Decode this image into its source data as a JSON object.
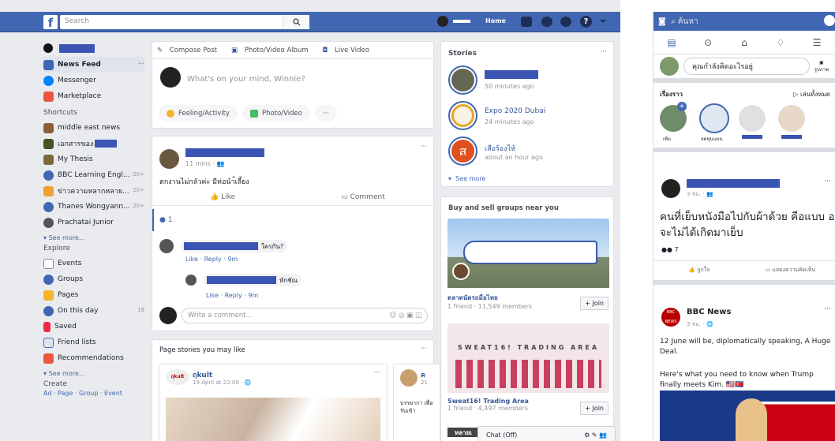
{
  "topbar": {
    "search_placeholder": "Search",
    "home": "Home"
  },
  "nav": {
    "items": [
      {
        "label": "News Feed",
        "more": "···"
      },
      {
        "label": "Messenger"
      },
      {
        "label": "Marketplace"
      }
    ],
    "shortcuts_heading": "Shortcuts",
    "shortcuts": [
      {
        "label": "middle east news",
        "count": ""
      },
      {
        "label": "เอกสารของ",
        "count": ""
      },
      {
        "label": "My Thesis",
        "count": ""
      },
      {
        "label": "BBC Learning Engl...",
        "count": "20+"
      },
      {
        "label": "ข่าวความหลากหลาย...",
        "count": "20+"
      },
      {
        "label": "Thanes Wongyann...",
        "count": "20+"
      },
      {
        "label": "Prachatai Junior",
        "count": ""
      }
    ],
    "see_more": "See more...",
    "explore_heading": "Explore",
    "explore": [
      {
        "label": "Events",
        "count": ""
      },
      {
        "label": "Groups",
        "count": ""
      },
      {
        "label": "Pages",
        "count": ""
      },
      {
        "label": "On this day",
        "count": "19"
      },
      {
        "label": "Saved",
        "count": ""
      },
      {
        "label": "Friend lists",
        "count": ""
      },
      {
        "label": "Recommendations",
        "count": ""
      }
    ],
    "see_more2": "See more...",
    "create_heading": "Create",
    "create_links": "Ad · Page · Group · Event",
    "icon_colors": [
      "#4267b2",
      "#0084ff",
      "#e9573f",
      "#8b5e3c",
      "#445522",
      "#7a6a3a",
      "#4267b2",
      "#f0a030",
      "#4267b2",
      "#555555",
      "#4267b2",
      "#4267b2",
      "#f5b42a",
      "#4267b2",
      "#f02849",
      "#4267b2",
      "#e9573f"
    ]
  },
  "composer": {
    "tabs": [
      "Compose Post",
      "Photo/Video Album",
      "Live Video"
    ],
    "placeholder": "What's on your mind, Winnie?",
    "chips": [
      "Feeling/Activity",
      "Photo/Video",
      "···"
    ]
  },
  "post": {
    "time": "11 mins · 👥",
    "text": "ตกงานไม่กลัวค่ะ มีห่อนำ้เลี้ยง",
    "like": "Like",
    "comment": "Comment",
    "reactions": "1",
    "comment1_text": "ใครกัน?",
    "comment1_meta": "Like · Reply · 9m",
    "comment2_text": "หักชัณ",
    "comment2_meta": "Like · Reply · 9m",
    "write_placeholder": "Write a comment...",
    "write_icons": "☺ ◎ ▣ ◫",
    "more": "···"
  },
  "pages_card": {
    "title": "Page stories you may like",
    "more": "···",
    "p1_name": "ฤkult",
    "p1_date": "19 April at 22:09 · 🌐",
    "p1_avatar": "ฤkult",
    "p2_name": "ค",
    "p2_date": "21",
    "p2_text": "บรรยากา เพื่อรับเข้า",
    "more2": "···"
  },
  "stories": {
    "title": "Stories",
    "more": "···",
    "items": [
      {
        "name": "",
        "time": "50 minutes ago"
      },
      {
        "name": "Expo 2020 Dubai",
        "time": "24 minutes ago"
      },
      {
        "name": "เสือร้องไห้",
        "time": "about an hour ago"
      }
    ],
    "see_more": "See more"
  },
  "groups": {
    "title": "Buy and sell groups near you",
    "items": [
      {
        "name": "ตลาดนัดรถมือไทย",
        "members": "1 friend · 11,549 members",
        "join": "+ Join"
      },
      {
        "name": "Sweat16! Trading Area",
        "members": "1 friend · 4,497 members",
        "join": "+ Join",
        "banner": "SWEAT16! TRADING AREA"
      }
    ],
    "g3_partial": "หลายเ"
  },
  "chat": {
    "label": "Chat (Off)",
    "icons": "⚙ ✎ 👥"
  },
  "mobile": {
    "search_placeholder": "ค้นหา",
    "composer_placeholder": "คุณกำลังคิดอะไรอยู่",
    "composer_icon_label": "รูปภาพ",
    "stories_heading": "เรื่องราว",
    "stories_play_all": "▷ เล่นทั้งหมด",
    "stories_labels": [
      "เพิ่ม",
      "ลดทุนแมน"
    ],
    "post1_time": "3 ชม. · 👥",
    "post1_text": "คนที่เย็บหนังมือไปกับผ้าด้วย คือแบบ อาจจะไม่ได้เกิดมาเย็บ",
    "post1_reactions": "7",
    "like": "ถูกใจ",
    "comment": "แสดงความคิดเห็น",
    "bbc_name": "BBC News",
    "bbc_time": "3 ชม. · 🌐",
    "bbc_avatar": "BBC NEWS",
    "bbc_text1": "12 June will be, diplomatically speaking, A Huge Deal.",
    "bbc_text2": "Here's what you need to know when Trump finally meets Kim. 🇺🇸🇰🇵",
    "more": "···"
  },
  "colors": {
    "brand": "#4267b2",
    "link": "#365899",
    "redacted": "#3b55b4",
    "bg": "#e9ebee"
  }
}
